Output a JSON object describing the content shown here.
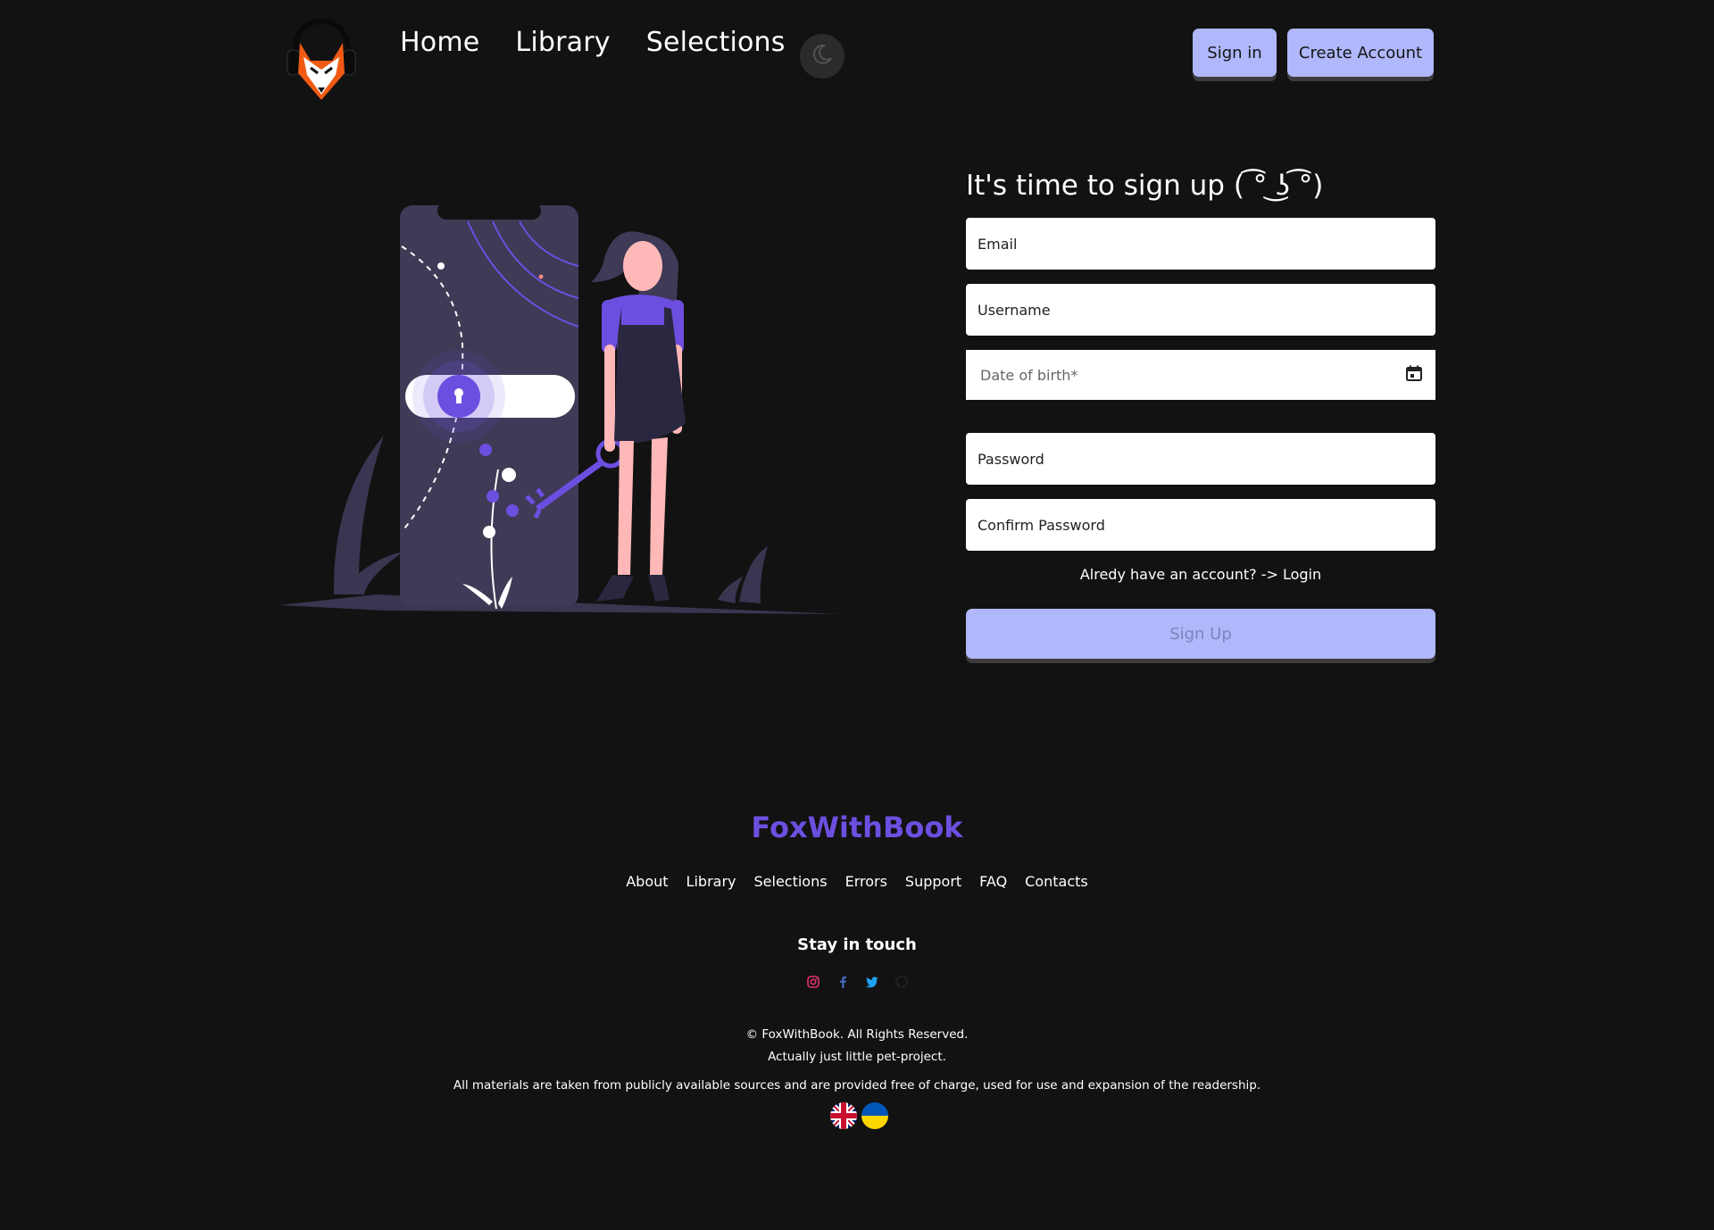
{
  "header": {
    "nav": [
      "Home",
      "Library",
      "Selections"
    ],
    "signin_label": "Sign in",
    "create_label": "Create Account"
  },
  "form": {
    "title": "It's time to sign up ( ͡° ͜ʖ ͡°)",
    "email_placeholder": "Email",
    "username_placeholder": "Username",
    "dob_placeholder": "Date of birth*",
    "password_placeholder": "Password",
    "confirm_placeholder": "Confirm Password",
    "login_link": "Alredy have an account? -> Login",
    "submit_label": "Sign Up"
  },
  "footer": {
    "brand": "FoxWithBook",
    "links": [
      "About",
      "Library",
      "Selections",
      "Errors",
      "Support",
      "FAQ",
      "Contacts"
    ],
    "stay_in_touch": "Stay in touch",
    "socials": [
      "instagram-icon",
      "facebook-icon",
      "twitter-icon",
      "github-icon"
    ],
    "copyright": "© FoxWithBook. All Rights Reserved.",
    "pet_project": "Actually just little pet-project.",
    "materials": "All materials are taken from publicly available sources and are provided free of charge, used for use and expansion of the readership.",
    "languages": [
      "english-flag-icon",
      "ukrainian-flag-icon"
    ]
  },
  "colors": {
    "background": "#121212",
    "accent_button": "#b0b7fb",
    "brand": "#6c4fe0"
  }
}
